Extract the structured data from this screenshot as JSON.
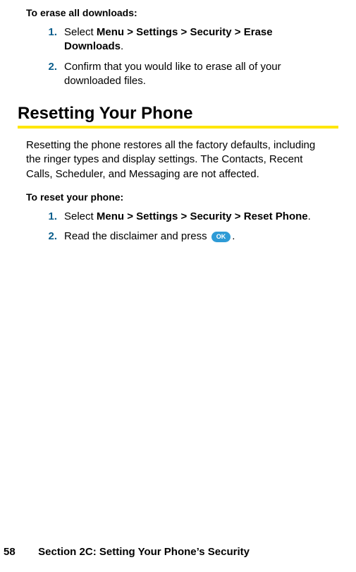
{
  "erase": {
    "intro": "To erase all downloads:",
    "steps": [
      {
        "num": "1.",
        "prefix": "Select ",
        "path1": "Menu",
        "sep1": " > ",
        "path2": "Settings",
        "sep2": " > ",
        "path3": "Security",
        "sep3": " > ",
        "path4": "Erase Downloads",
        "suffix": "."
      },
      {
        "num": "2.",
        "text": "Confirm that you would like to erase all of your downloaded files."
      }
    ]
  },
  "heading": "Resetting Your Phone",
  "reset": {
    "para": "Resetting the phone restores all the factory defaults, including the ringer types and display settings. The Contacts, Recent Calls, Scheduler, and Messaging are not affected.",
    "intro": "To reset your phone:",
    "steps": [
      {
        "num": "1.",
        "prefix": "Select ",
        "path1": "Menu",
        "sep1": " > ",
        "path2": "Settings",
        "sep2": " > ",
        "path3": "Security",
        "sep3": " > ",
        "path4": "Reset Phone",
        "suffix": "."
      },
      {
        "num": "2.",
        "textBefore": "Read the disclaimer and press ",
        "button": "OK",
        "textAfter": "."
      }
    ]
  },
  "footer": {
    "page": "58",
    "section": "Section 2C: Setting Your Phone’s Security"
  }
}
